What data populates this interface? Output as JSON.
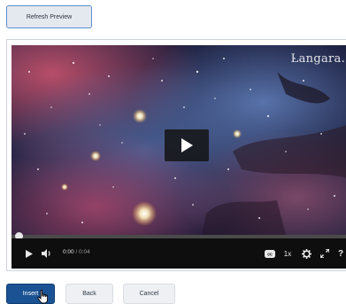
{
  "toolbar": {
    "refresh_label": "Refresh Preview"
  },
  "video": {
    "watermark": "Langara.",
    "current_time": "0:00",
    "duration": "/ 0:04",
    "playback_speed": "1x",
    "progress": 0.0,
    "icons": {
      "play_overlay": "play-icon",
      "play": "play-icon",
      "volume": "volume-icon",
      "captions": "closed-captions-icon",
      "settings": "gear-icon",
      "fullscreen": "fullscreen-icon",
      "help": "help-icon"
    },
    "help_glyph": "?"
  },
  "actions": {
    "insert_label": "Insert",
    "back_label": "Back",
    "cancel_label": "Cancel"
  },
  "colors": {
    "primary": "#1b5293",
    "refresh_border": "#5a8fd0"
  }
}
